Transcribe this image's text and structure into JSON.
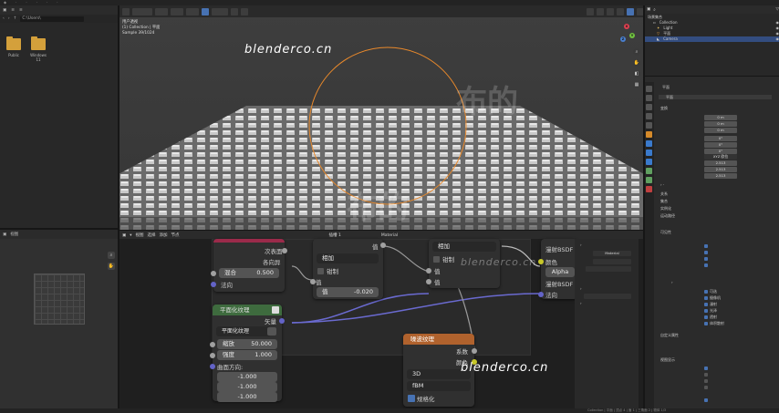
{
  "file_browser": {
    "path": "C:\\Users\\",
    "folders": [
      "Public",
      "Windows 11"
    ]
  },
  "viewport": {
    "info_lines": [
      "用户透视",
      "(1) Collection | 平面",
      "Sample 39/1024"
    ],
    "watermarks": [
      "blenderco.cn",
      "blenderco.cn",
      "blenderco.cn"
    ],
    "big_watermarks": [
      "布的",
      "布的"
    ],
    "axes": [
      "X",
      "Y",
      "Z"
    ],
    "accent_color": "#e9892b"
  },
  "outliner": {
    "title": "场景集合",
    "items": [
      "Collection",
      "Light",
      "平面",
      "Camera"
    ]
  },
  "properties": {
    "object_name": "平面",
    "sections": {
      "transform": "变换",
      "relations": "关系",
      "collections": "集合",
      "instancing": "实例化",
      "motion_paths": "运动路径",
      "visibility": "可见性",
      "viewport_display": "视图显示",
      "custom_props": "自定义属性"
    },
    "location": [
      "0 m",
      "0 m",
      "0 m"
    ],
    "rotation": [
      "0°",
      "0°",
      "0°"
    ],
    "mode": "XYZ 欧拉",
    "scale": [
      "2.513",
      "2.513",
      "2.513"
    ],
    "visibility_checks": [
      "可选",
      "摄像机",
      "漫射",
      "光泽",
      "透射",
      "体积散射",
      "阴影"
    ]
  },
  "node_editor": {
    "menus": [
      "视图",
      "选择",
      "添加",
      "节点"
    ],
    "slot": "插槽 1",
    "material": "Material",
    "nodes": {
      "mix_top": {
        "label1": "次表面",
        "label2": "各向异",
        "mix_label": "混合",
        "mix_value": "0.500",
        "normal": "法向"
      },
      "math": {
        "op": "相加",
        "clamp": "钳制",
        "value_label": "值",
        "value": "-0.020"
      },
      "ramp": {
        "op": "相加",
        "clamp": "钳制",
        "value_label": "值"
      },
      "bsdf": {
        "color": "颜色",
        "alpha": "Alpha",
        "normal": "法向",
        "mat": "漫射BSDF"
      },
      "brick": {
        "title": "平面化纹理",
        "subtitle": "平面化纹理",
        "output": "矢量",
        "scale_label": "缩放",
        "scale_value": "50.000",
        "strength_label": "强度",
        "strength_value": "1.000",
        "dir_label": "曲面方向:",
        "dirs": [
          "-1.000",
          "-1.000",
          "-1.000"
        ]
      },
      "noise": {
        "title": "噪波纹理",
        "factor": "系数",
        "color": "颜色",
        "dim": "3D",
        "type": "fBM",
        "normalize": "规格化"
      }
    }
  },
  "status": "Collection | 平面 | 顶点 4 | 面 1 | 三角面 2 | 物体 1/3"
}
